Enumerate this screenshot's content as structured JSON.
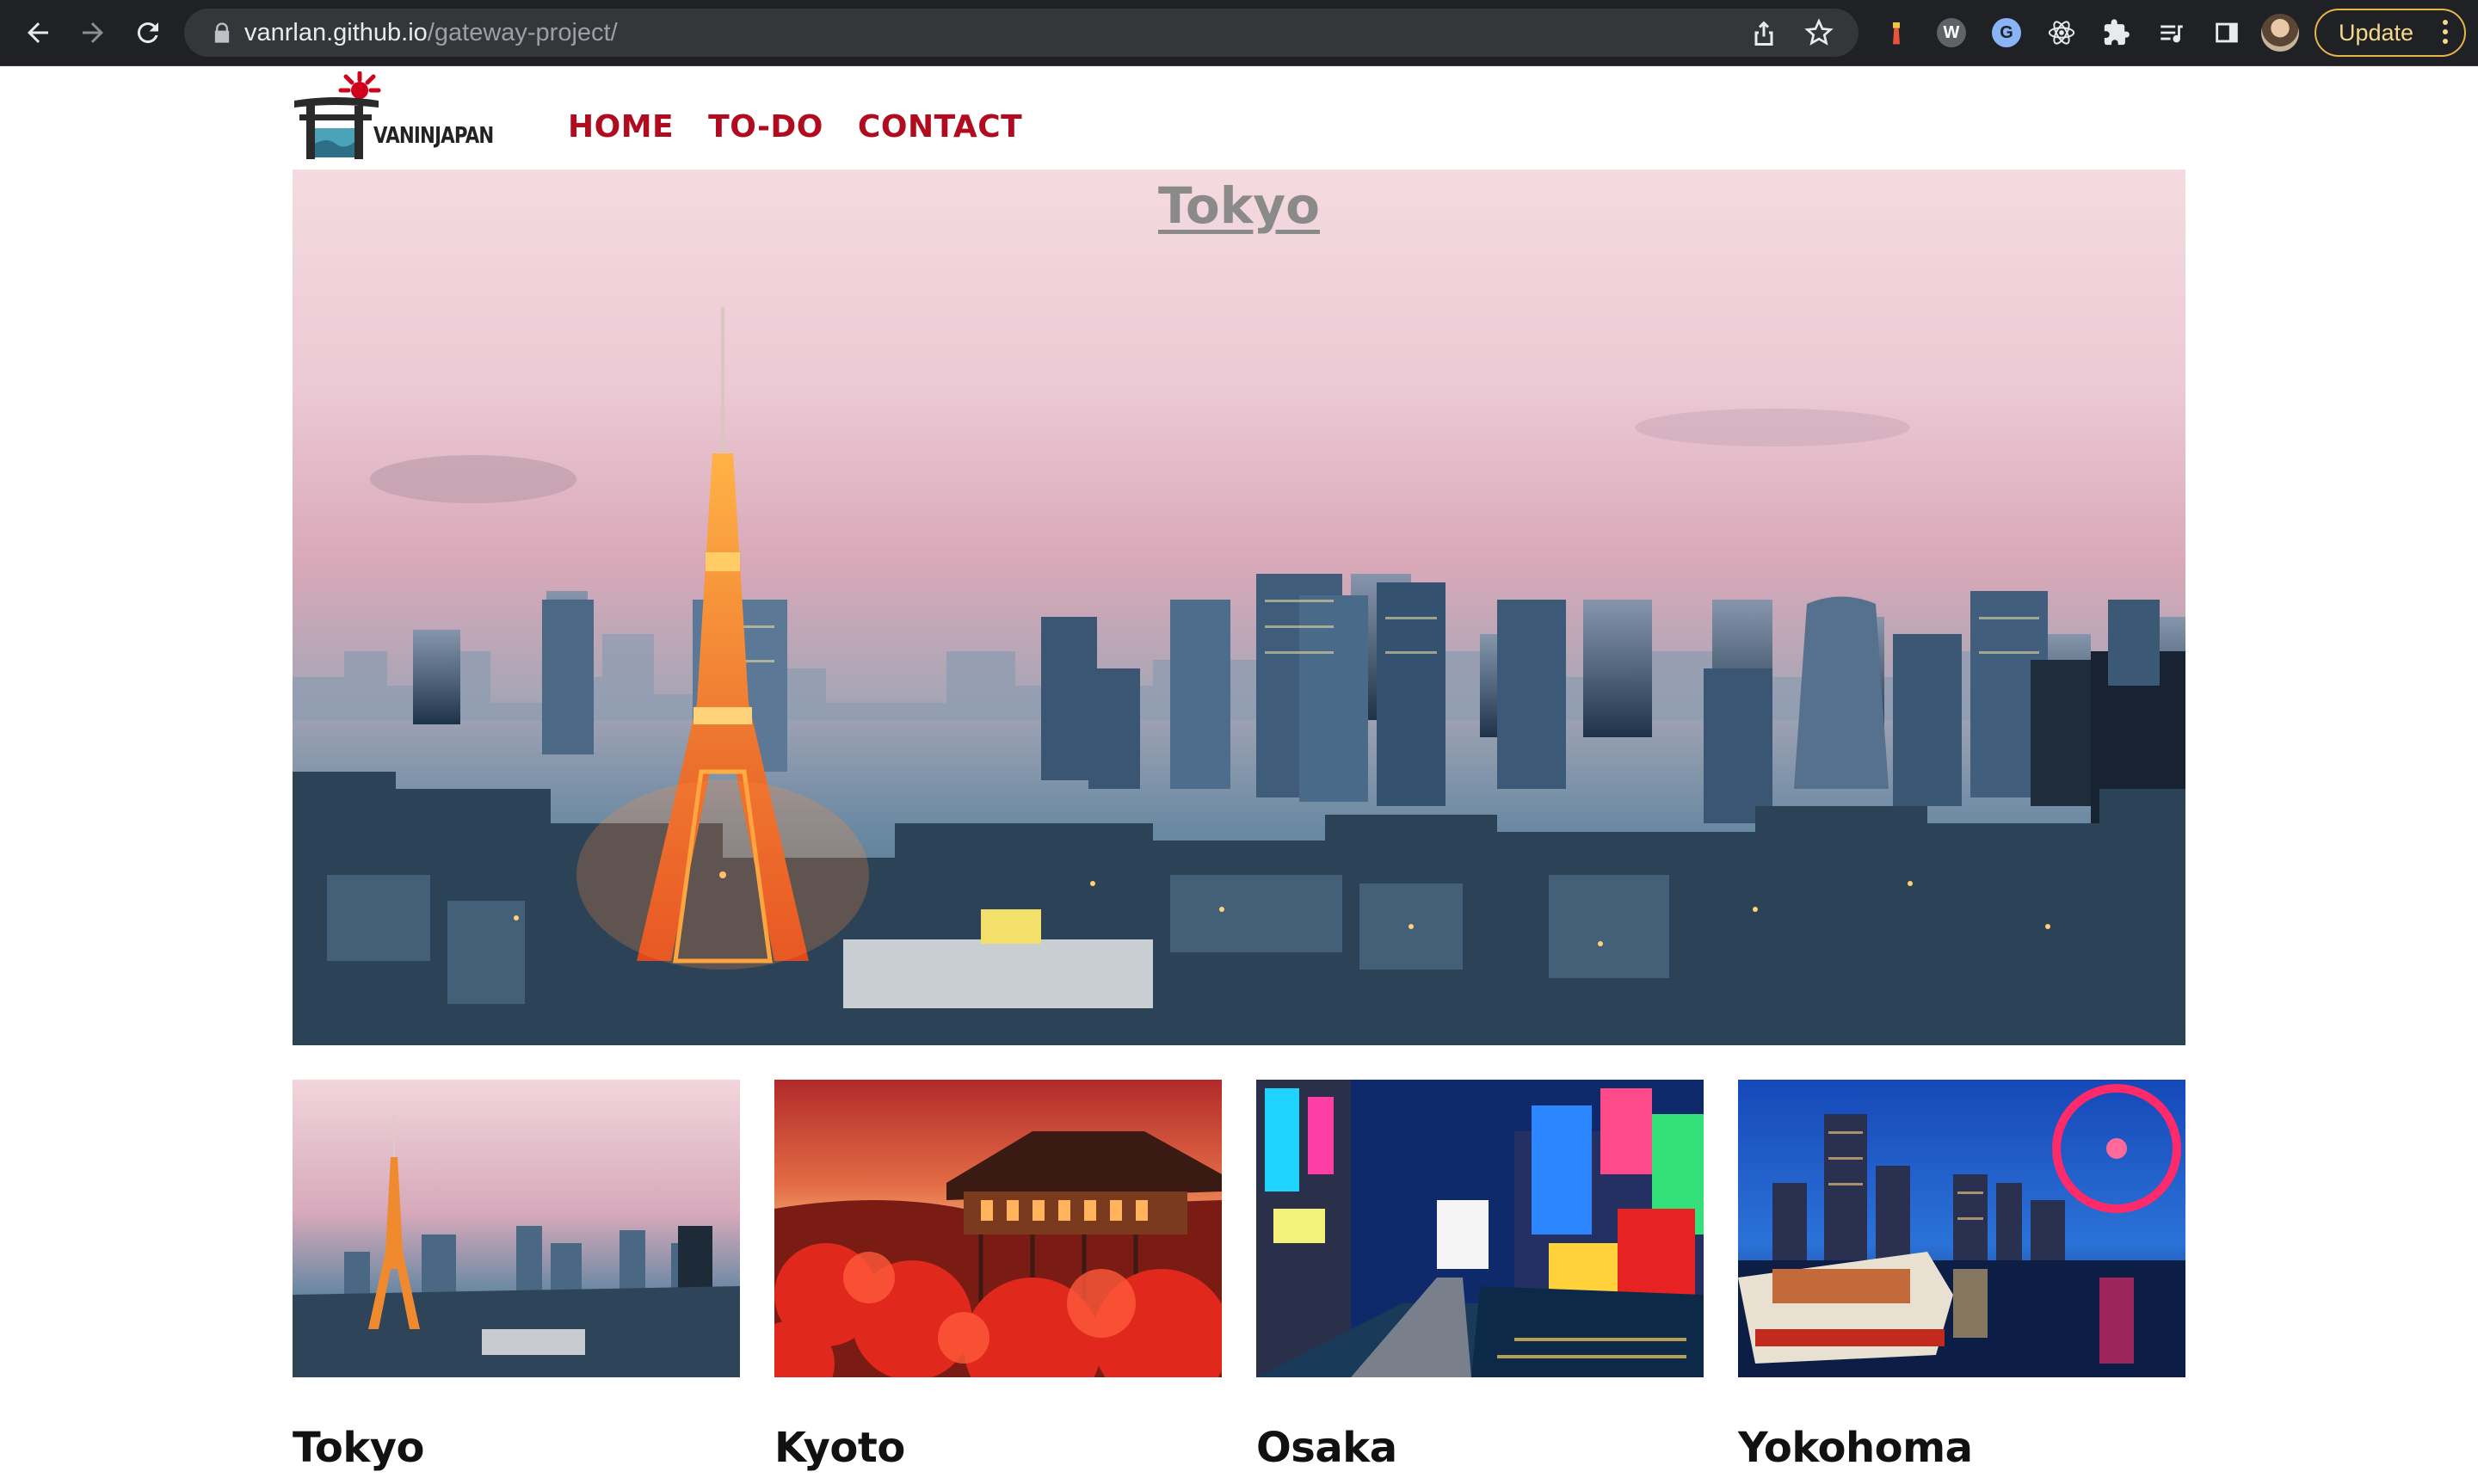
{
  "browser": {
    "url_host": "vanrlan.github.io",
    "url_path": "/gateway-project/",
    "update_label": "Update"
  },
  "site": {
    "logo_text": "VANINJAPAN",
    "nav": [
      {
        "label": "HOME"
      },
      {
        "label": "TO-DO"
      },
      {
        "label": "CONTACT"
      }
    ],
    "hero_title": "Tokyo",
    "cities": [
      {
        "label": "Tokyo"
      },
      {
        "label": "Kyoto"
      },
      {
        "label": "Osaka"
      },
      {
        "label": "Yokohoma"
      }
    ]
  },
  "colors": {
    "nav_link": "#b00b1e",
    "update_outline": "#e6b64c",
    "chrome_bg": "#202124"
  },
  "icons": [
    "back-arrow-icon",
    "forward-arrow-icon",
    "reload-icon",
    "lock-icon",
    "share-icon",
    "star-icon",
    "extension-icon",
    "menu-dots-icon"
  ]
}
